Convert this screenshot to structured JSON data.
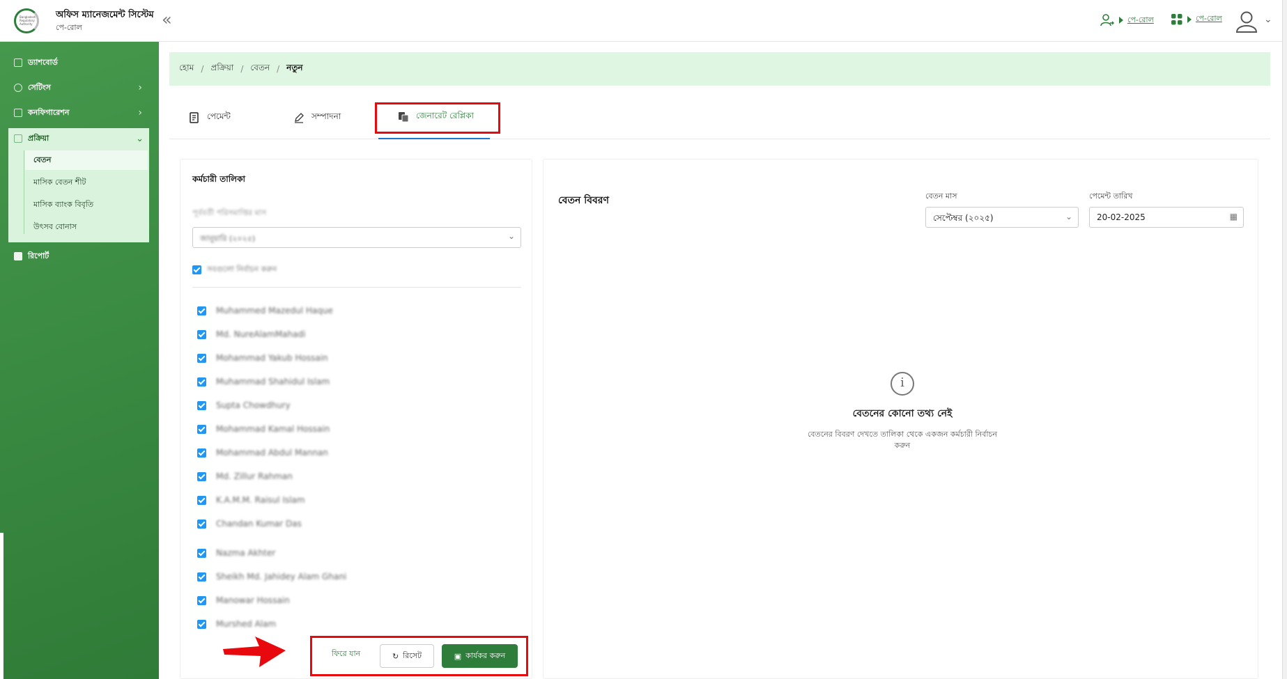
{
  "header": {
    "app_title": "অফিস ম্যানেজমেন্ট সিস্টেম",
    "app_subtitle": "পে-রোল",
    "logo_text": "Bangladesh Regulatory Authority",
    "links": [
      {
        "label": "পে-রোল",
        "icon": "user-switch-icon"
      },
      {
        "label": "পে-রোল",
        "icon": "apps-grid-icon"
      }
    ]
  },
  "sidebar": {
    "items": [
      {
        "label": "ড্যাশবোর্ড",
        "icon": "dashboard-icon"
      },
      {
        "label": "সেটিংস",
        "icon": "gear-icon"
      },
      {
        "label": "কনফিগারেশন",
        "icon": "sliders-icon"
      },
      {
        "label": "প্রক্রিয়া",
        "icon": "list-icon"
      },
      {
        "label": "রিপোর্ট",
        "icon": "document-icon"
      }
    ],
    "sub_items": [
      {
        "label": "বেতন",
        "active": true
      },
      {
        "label": "মাসিক বেতন শীট",
        "active": false
      },
      {
        "label": "মাসিক ব্যাংক বিবৃতি",
        "active": false
      },
      {
        "label": "উৎসব বোনাস",
        "active": false
      }
    ]
  },
  "breadcrumb": [
    "হোম",
    "প্রক্রিয়া",
    "বেতন",
    "নতুন"
  ],
  "tabs": [
    {
      "label": "পেমেন্ট",
      "icon": "payment-icon"
    },
    {
      "label": "সম্পাদনা",
      "icon": "pencil-icon"
    },
    {
      "label": "জেনারেট রেপ্লিকা",
      "icon": "copy-document-icon",
      "active": true
    }
  ],
  "employee_panel": {
    "title": "কর্মচারী তালিকা",
    "prev_month_label": "পূর্ববর্তী পরিসমাপ্তির মাস",
    "prev_month_value": "জানুয়ারি (২০২৫)",
    "select_all_label": "সবগুলো নির্বাচন করুন",
    "employees": [
      "Muhammed Mazedul Haque",
      "Md. NureAlamMahadi",
      "Mohammad Yakub Hossain",
      "Muhammad Shahidul Islam",
      "Supta Chowdhury",
      "Mohammad Kamal Hossain",
      "Mohammad Abdul Mannan",
      "Md. Zillur Rahman",
      "K.A.M.M. Raisul Islam",
      "Chandan Kumar Das",
      "Nazma Akhter",
      "Sheikh Md. Jahidey Alam Ghani",
      "Manowar Hossain",
      "Murshed Alam"
    ],
    "buttons": {
      "back": "ফিরে যান",
      "reset": "রিসেট",
      "execute": "কার্যকর করুন"
    }
  },
  "salary_panel": {
    "title": "বেতন বিবরণ",
    "month_label": "বেতন মাস",
    "month_value": "সেপ্টেম্বর (২০২৫)",
    "date_label": "পেমেন্ট তারিখ",
    "date_value": "20-02-2025",
    "empty_title": "বেতনের কোনো তথ্য নেই",
    "empty_desc": "বেতনের বিবরণ দেখতে তালিকা থেকে একজন কর্মচারী নির্বাচন করুন"
  },
  "colors": {
    "primary_green": "#2e7d3b",
    "sidebar_green": "#3d8f45",
    "breadcrumb_bg": "#dff6e2",
    "highlight_red": "#e8090f",
    "checkbox_blue": "#2196f3"
  }
}
